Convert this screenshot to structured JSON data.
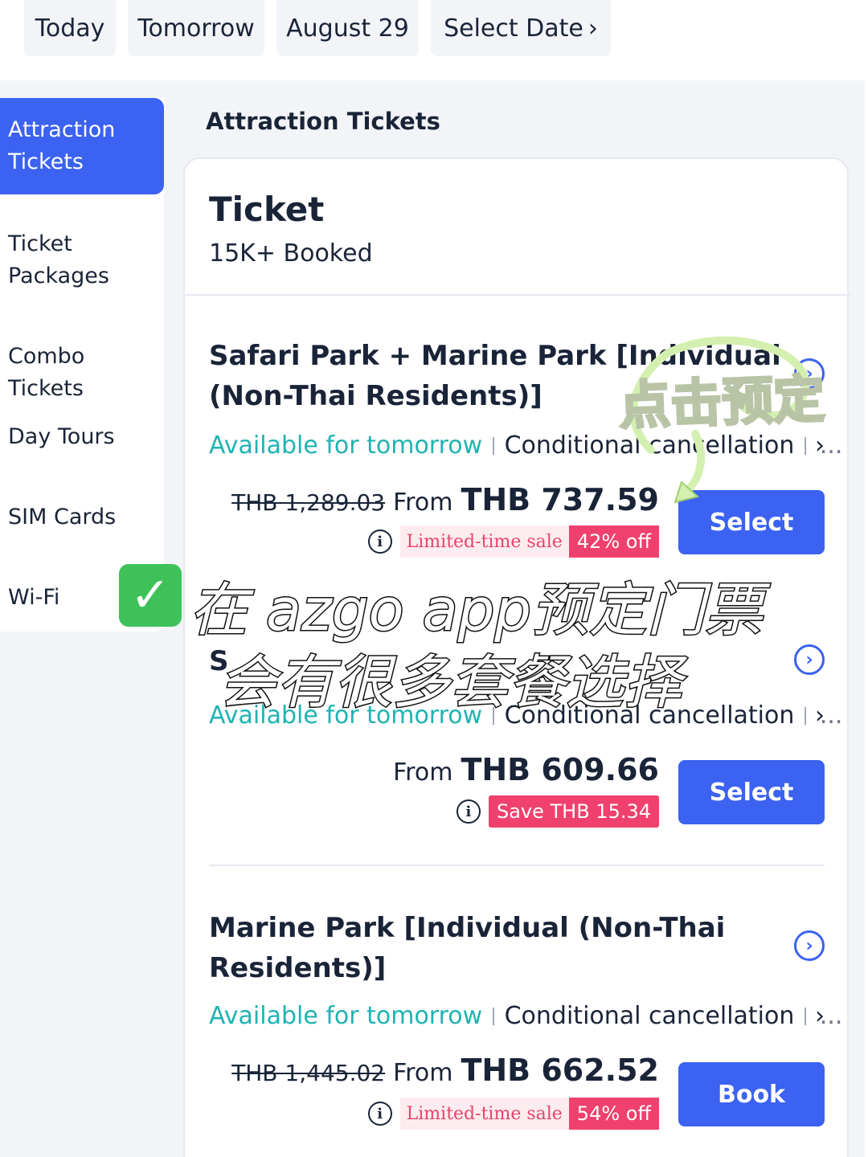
{
  "date_tabs": [
    {
      "label": "Today"
    },
    {
      "label": "Tomorrow"
    },
    {
      "label": "August 29"
    },
    {
      "label": "Select Date"
    }
  ],
  "sidebar": {
    "items": [
      {
        "label": "Attraction\nTickets",
        "active": true
      },
      {
        "label": "Ticket\nPackages"
      },
      {
        "label": "Combo Tickets"
      },
      {
        "label": "Day Tours"
      },
      {
        "label": "SIM Cards"
      },
      {
        "label": "Wi-Fi"
      }
    ]
  },
  "section_title": "Attraction Tickets",
  "card": {
    "title": "Ticket",
    "booked": "15K+ Booked"
  },
  "packages": [
    {
      "title": "Safari Park + Marine Park [Individual (Non-Thai Residents)]",
      "availability": "Available for tomorrow",
      "cancellation": "Conditional cancellation",
      "more": "...",
      "old_price": "THB 1,289.03",
      "from": "From",
      "price": "THB 737.59",
      "sale_label": "Limited-time sale",
      "discount": "42% off",
      "button": "Select"
    },
    {
      "title": "S",
      "availability": "Available for tomorrow",
      "cancellation": "Conditional cancellation",
      "more": "...",
      "from": "From",
      "price": "THB 609.66",
      "save": "Save THB 15.34",
      "button": "Select"
    },
    {
      "title": "Marine Park [Individual (Non-Thai Residents)]",
      "availability": "Available for tomorrow",
      "cancellation": "Conditional cancellation",
      "more": "...",
      "old_price": "THB 1,445.02",
      "from": "From",
      "price": "THB 662.52",
      "sale_label": "Limited-time sale",
      "discount": "54% off",
      "button": "Book"
    }
  ],
  "overlay": {
    "tap_hint": "点击预定",
    "line1": "在 azgo app预定门票",
    "line2": "会有很多套餐选择"
  },
  "icons": {
    "info": "info-icon",
    "chevron": "chevron-right-icon",
    "circle_chevron": "circle-chevron-right-icon",
    "check": "check-mark-icon",
    "arrow": "curved-arrow-icon"
  },
  "colors": {
    "accent": "#3b62f0",
    "availability": "#1fb3b3",
    "sale": "#f0416e",
    "check": "#3fc15a"
  }
}
